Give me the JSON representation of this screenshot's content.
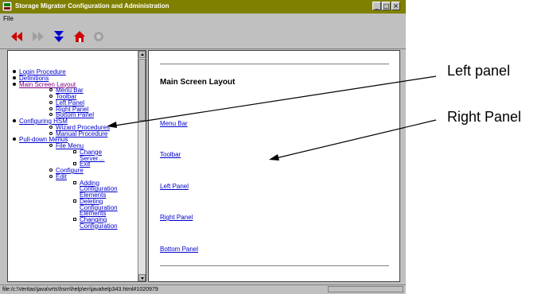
{
  "window": {
    "title": "Storage Migrator Configuration and Administration",
    "title_bar_color": "#808000",
    "controls": [
      "minimize",
      "maximize",
      "close"
    ]
  },
  "menubar": {
    "file_label": "File"
  },
  "toolbar": {
    "icons": [
      "back-icon",
      "forward-icon",
      "down-icon",
      "home-icon",
      "stop-icon"
    ]
  },
  "left_tree": {
    "items": [
      {
        "label": "Login Procedure",
        "level": 1,
        "bullet": "dot"
      },
      {
        "label": "Definitions",
        "level": 1,
        "bullet": "dot"
      },
      {
        "label": "Main Screen Layout",
        "level": 1,
        "bullet": "dot",
        "visited": true
      },
      {
        "label": "Menu Bar",
        "level": 2,
        "bullet": "ring"
      },
      {
        "label": "Toolbar",
        "level": 2,
        "bullet": "ring"
      },
      {
        "label": "Left Panel",
        "level": 2,
        "bullet": "ring"
      },
      {
        "label": "Right Panel",
        "level": 2,
        "bullet": "ring"
      },
      {
        "label": "Bottom Panel",
        "level": 2,
        "bullet": "ring"
      },
      {
        "label": "Configuring HSM",
        "level": 1,
        "bullet": "dot"
      },
      {
        "label": "Wizard Procedures",
        "level": 2,
        "bullet": "ring"
      },
      {
        "label": "Manual Procedure",
        "level": 2,
        "bullet": "ring"
      },
      {
        "label": "Pull-down Menus",
        "level": 1,
        "bullet": "dot"
      },
      {
        "label": "File Menu",
        "level": 2,
        "bullet": "ring"
      },
      {
        "label": "Change",
        "level": 3,
        "bullet": "square"
      },
      {
        "label": "Server…",
        "level": 3,
        "bullet": "none"
      },
      {
        "label": "Exit",
        "level": 3,
        "bullet": "square"
      },
      {
        "label": "Configure",
        "level": 2,
        "bullet": "ring"
      },
      {
        "label": "Edit",
        "level": 2,
        "bullet": "ring"
      },
      {
        "label": "Adding",
        "level": 3,
        "bullet": "square"
      },
      {
        "label": "Configuration",
        "level": 3,
        "bullet": "none"
      },
      {
        "label": "Elements",
        "level": 3,
        "bullet": "none"
      },
      {
        "label": "Deleting",
        "level": 3,
        "bullet": "square"
      },
      {
        "label": "Configuration",
        "level": 3,
        "bullet": "none"
      },
      {
        "label": "Elements",
        "level": 3,
        "bullet": "none"
      },
      {
        "label": "Changing",
        "level": 3,
        "bullet": "square"
      },
      {
        "label": "Configuration",
        "level": 3,
        "bullet": "none"
      }
    ]
  },
  "right_content": {
    "heading": "Main Screen Layout",
    "links": [
      "Menu Bar",
      "Toolbar",
      "Left Panel",
      "Right Panel",
      "Bottom Panel"
    ]
  },
  "statusbar": {
    "text": "file:/c:\\Veritas\\java\\vrts\\hsm\\help\\en\\javahelp343.html#1020979"
  },
  "annotations": {
    "left_panel_label": "Left panel",
    "right_panel_label": "Right Panel"
  }
}
